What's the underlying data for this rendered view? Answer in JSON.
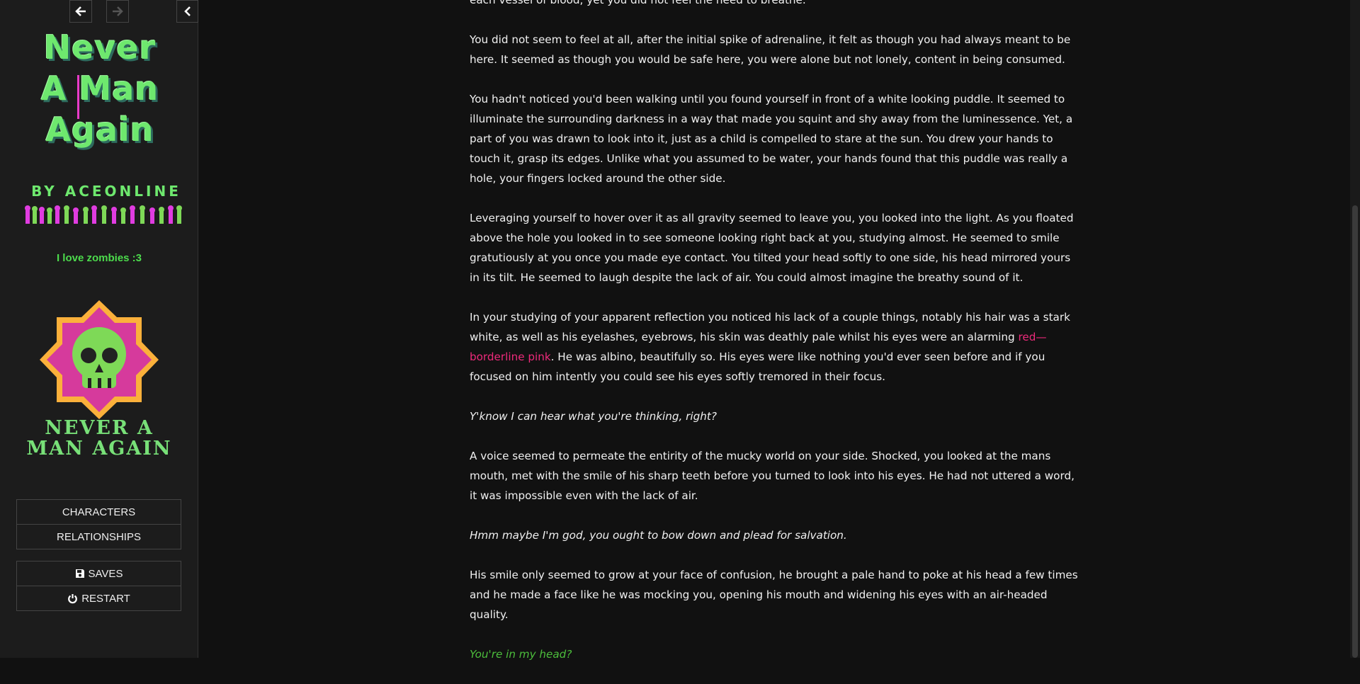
{
  "sidebar": {
    "title_lines": [
      "Never",
      "A Man",
      "Again"
    ],
    "byline": "BY ACEONLINE",
    "subtitle": "I love zombies :3",
    "badge_text": "NEVER A MAN AGAIN",
    "menu_top": [
      {
        "label": "CHARACTERS"
      },
      {
        "label": "RELATIONSHIPS"
      }
    ],
    "menu_bottom": [
      {
        "label": "SAVES",
        "icon": "floppy-disk-icon"
      },
      {
        "label": "RESTART",
        "icon": "power-icon"
      }
    ]
  },
  "passage": {
    "p0": "each vessel of blood, yet you did not feel the need to breathe.",
    "p1": "You did not seem to feel at all, after the initial spike of adrenaline, it felt as though you had always meant to be here. It seemed as though you would be safe here, you were alone but not lonely, content in being consumed.",
    "p2": "You hadn't noticed you'd been walking until you found yourself in front of a white looking puddle. It seemed to illuminate the surrounding darkness in a way that made you squint and shy away from the luminessence. Yet, a part of you was drawn to look into it, just as a child is compelled to stare at the sun. You drew your hands to touch it, grasp its edges. Unlike what you assumed to be water, your hands found that this puddle was really a hole, your fingers locked around the other side.",
    "p3": "Leveraging yourself to hover over it as all gravity seemed to leave you, you looked into the light. As you floated above the hole you looked in to see someone looking right back at you, studying almost. He seemed to smile gratutiously at you once you made eye contact. You tilted your head softly to one side, his head mirrored yours in its tilt. He seemed to laugh despite the lack of air. You could almost imagine the breathy sound of it.",
    "p4a": "In your studying of your apparent reflection you noticed his lack of a couple things, notably his hair was a stark white, as well as his eyelashes, eyebrows, his skin was deathly pale whilst his eyes were an alarming ",
    "p4b": "red— borderline pink",
    "p4c": ". He was albino, beautifully so. His eyes were like nothing you'd ever seen before and if you focused on him intently you could see his eyes softly tremored in their focus.",
    "p5": "Y'know I can hear what you're thinking, right?",
    "p6": "A voice seemed to permeate the entirity of the mucky world on your side. Shocked, you looked at the mans mouth, met with the smile of his sharp teeth before you turned to look into his eyes. He had not uttered a word, it was impossible even with the lack of air.",
    "p7": "Hmm maybe I'm god, you ought to bow down and plead for salvation.",
    "p8": "His smile only seemed to grow at your face of confusion, he brought a pale hand to poke at his head a few times and he made a face like he was mocking you, opening his mouth and widening his eyes with an air-headed quality.",
    "p9": "You're in my head?"
  },
  "colors": {
    "background": "#111111",
    "sidebar": "#1c1c1c",
    "title_green": "#6ee86e",
    "accent_pink": "#ee2a7b",
    "dialogue_green": "#4cbe3c"
  }
}
